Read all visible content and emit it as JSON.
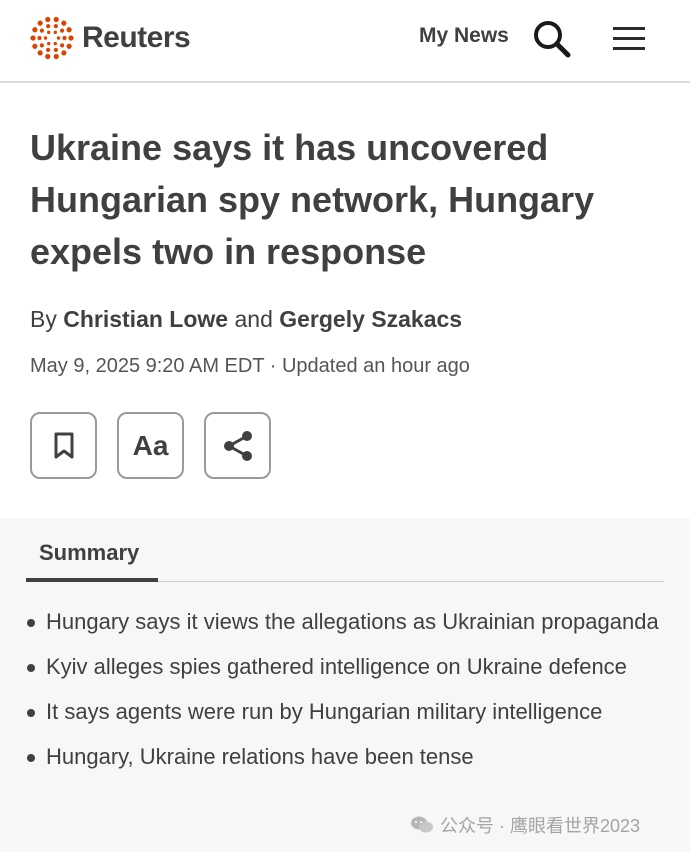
{
  "header": {
    "brand": "Reuters",
    "brand_color": "#dc4300",
    "my_news_label": "My News",
    "search_icon": "search-icon",
    "menu_icon": "hamburger-menu-icon"
  },
  "article": {
    "title": "Ukraine says it has uncovered Hungarian spy network, Hungary expels two in response",
    "byline_prefix": "By",
    "author_1": "Christian Lowe",
    "byline_and": "and",
    "author_2": "Gergely Szakacs",
    "dateline": "May 9, 2025 9:20 AM EDT · Updated an hour ago"
  },
  "toolbar": {
    "bookmark_icon": "bookmark-icon",
    "text_size_label": "Aa",
    "share_icon": "share-icon"
  },
  "summary": {
    "tab_label": "Summary",
    "items": [
      "Hungary says it views the allegations as Ukrainian propaganda",
      "Kyiv alleges spies gathered intelligence on Ukraine defence",
      "It says agents were run by Hungarian military intelligence",
      "Hungary, Ukraine relations have been tense"
    ]
  },
  "watermark": {
    "text": "公众号 · 鹰眼看世界2023"
  }
}
